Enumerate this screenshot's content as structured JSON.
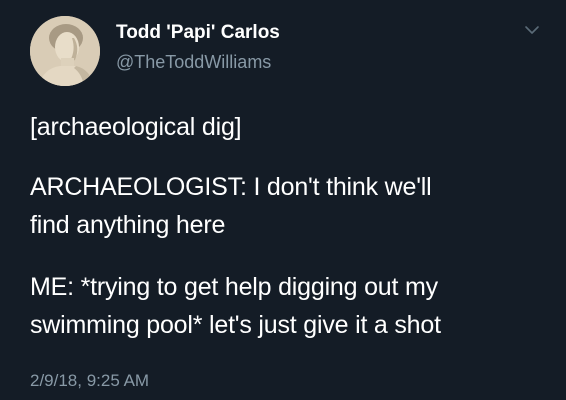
{
  "author": {
    "display_name": "Todd 'Papi' Carlos",
    "handle": "@TheToddWilliams",
    "avatar_icon": "classical-statue-bust-avatar"
  },
  "menu": {
    "icon": "chevron-down-icon"
  },
  "tweet": {
    "paragraphs": [
      {
        "lines": [
          "[archaeological dig]"
        ]
      },
      {
        "lines": [
          "ARCHAEOLOGIST: I don't think we'll",
          "find anything here"
        ]
      },
      {
        "lines": [
          "ME: *trying to get help digging out my",
          "swimming pool* let's just give it a shot"
        ]
      }
    ],
    "timestamp": "2/9/18, 9:25 AM"
  },
  "colors": {
    "background": "#141c26",
    "primary_text": "#ffffff",
    "secondary_text": "#8899a6"
  }
}
